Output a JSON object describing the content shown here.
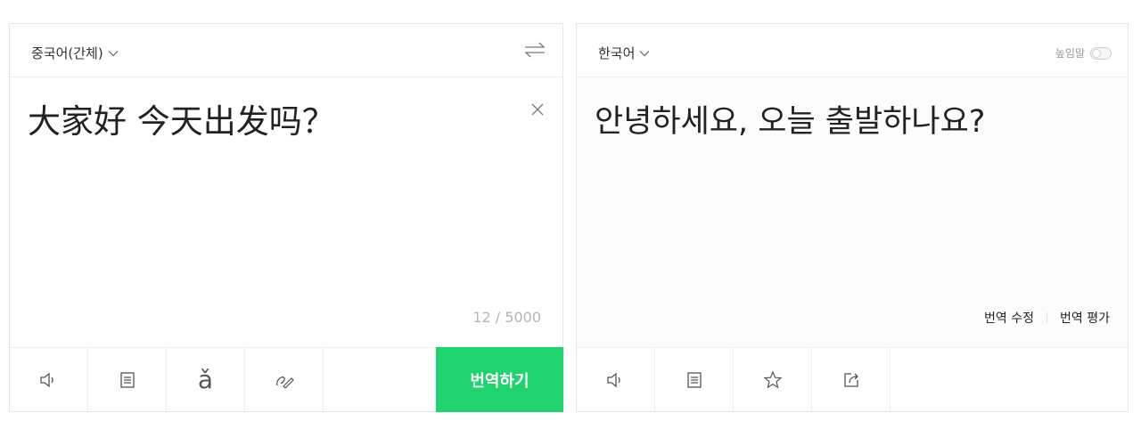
{
  "source": {
    "language": "중국어(간체)",
    "text": "大家好 今天出发吗？",
    "char_count": "12 / 5000",
    "translate_button": "번역하기",
    "tools": [
      "speaker-icon",
      "copy-icon",
      "pinyin-icon",
      "handwriting-icon"
    ],
    "pinyin_glyph": "ǎ"
  },
  "target": {
    "language": "한국어",
    "honorific_label": "높임말",
    "honorific_on": false,
    "text": "안녕하세요, 오늘 출발하나요?",
    "edit_link": "번역 수정",
    "rate_link": "번역 평가",
    "tools": [
      "speaker-icon",
      "copy-icon",
      "star-icon",
      "share-icon"
    ]
  },
  "colors": {
    "accent": "#1fd36e",
    "border": "#e6e6e6",
    "muted_text": "#b5b5b5"
  }
}
